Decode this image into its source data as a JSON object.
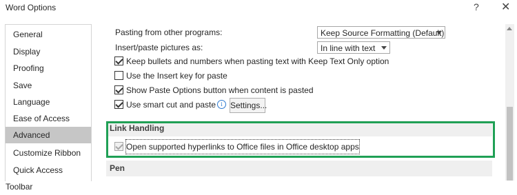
{
  "window": {
    "title": "Word Options",
    "help": "?",
    "close": "✕"
  },
  "sidebar": {
    "items": [
      {
        "label": "General",
        "active": false
      },
      {
        "label": "Display",
        "active": false
      },
      {
        "label": "Proofing",
        "active": false
      },
      {
        "label": "Save",
        "active": false
      },
      {
        "label": "Language",
        "active": false
      },
      {
        "label": "Ease of Access",
        "active": false
      },
      {
        "label": "Advanced",
        "active": true
      },
      {
        "label": "Customize Ribbon",
        "active": false
      },
      {
        "label": "Quick Access Toolbar",
        "active": false
      }
    ]
  },
  "content": {
    "paste_other": {
      "label": "Pasting from other programs:",
      "value": "Keep Source Formatting (Default)"
    },
    "insert_pictures": {
      "label": "Insert/paste pictures as:",
      "value": "In line with text"
    },
    "options": [
      {
        "label": "Keep bullets and numbers when pasting text with Keep Text Only option",
        "checked": true
      },
      {
        "label": "Use the Insert key for paste",
        "checked": false
      },
      {
        "label": "Show Paste Options button when content is pasted",
        "checked": true
      },
      {
        "label": "Use smart cut and paste",
        "checked": true
      }
    ],
    "info_icon": "i",
    "settings_button": "Settings...",
    "link_handling": {
      "header": "Link Handling",
      "option": {
        "label": "Open supported hyperlinks to Office files in Office desktop apps",
        "checked": true,
        "disabled": true
      }
    },
    "pen": {
      "header": "Pen"
    }
  },
  "colors": {
    "highlight": "#1fa055",
    "active_nav": "#c6c6c6",
    "info": "#2b79d0"
  },
  "scrollbar": {
    "up_icon": "scroll-up-arrow"
  }
}
